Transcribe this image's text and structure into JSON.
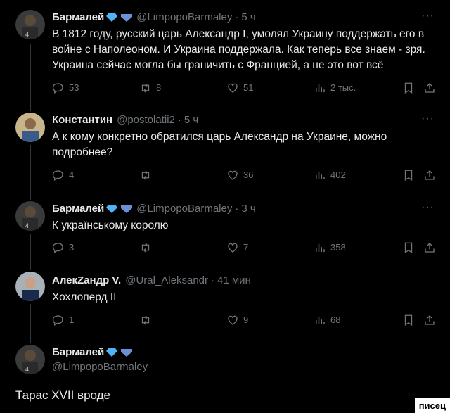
{
  "tweets": [
    {
      "name": "Бармалей",
      "handle": "@LimpopoBarmaley",
      "time": "5 ч",
      "text": "В 1812 году, русский царь Александр I, умолял Украину поддержать его в войне с Наполеоном. И Украина поддержала. Как теперь все знаем - зря. Украина сейчас могла бы граничить с Францией, а не это вот всё",
      "replies": "53",
      "retweets": "8",
      "likes": "51",
      "views": "2 тыс."
    },
    {
      "name": "Константин",
      "handle": "@postolatii2",
      "time": "5 ч",
      "text": "А к кому конкретно обратился царь Александр на Украине, можно подробнее?",
      "replies": "4",
      "retweets": "",
      "likes": "36",
      "views": "402"
    },
    {
      "name": "Бармалей",
      "handle": "@LimpopoBarmaley",
      "time": "3 ч",
      "text": "К українському королю",
      "replies": "3",
      "retweets": "",
      "likes": "7",
      "views": "358"
    },
    {
      "name": "АлекZандр V.",
      "handle": "@Ural_Aleksandr",
      "time": "41 мин",
      "text": "Хохлоперд II",
      "replies": "1",
      "retweets": "",
      "likes": "9",
      "views": "68"
    }
  ],
  "last": {
    "name": "Бармалей",
    "handle": "@LimpopoBarmaley",
    "text": "Тарас XVII  вроде"
  },
  "watermark": "писец",
  "colors": {
    "background": "#000000",
    "text": "#e7e9ea",
    "muted": "#71767b",
    "badge": "#1d9bf0"
  }
}
